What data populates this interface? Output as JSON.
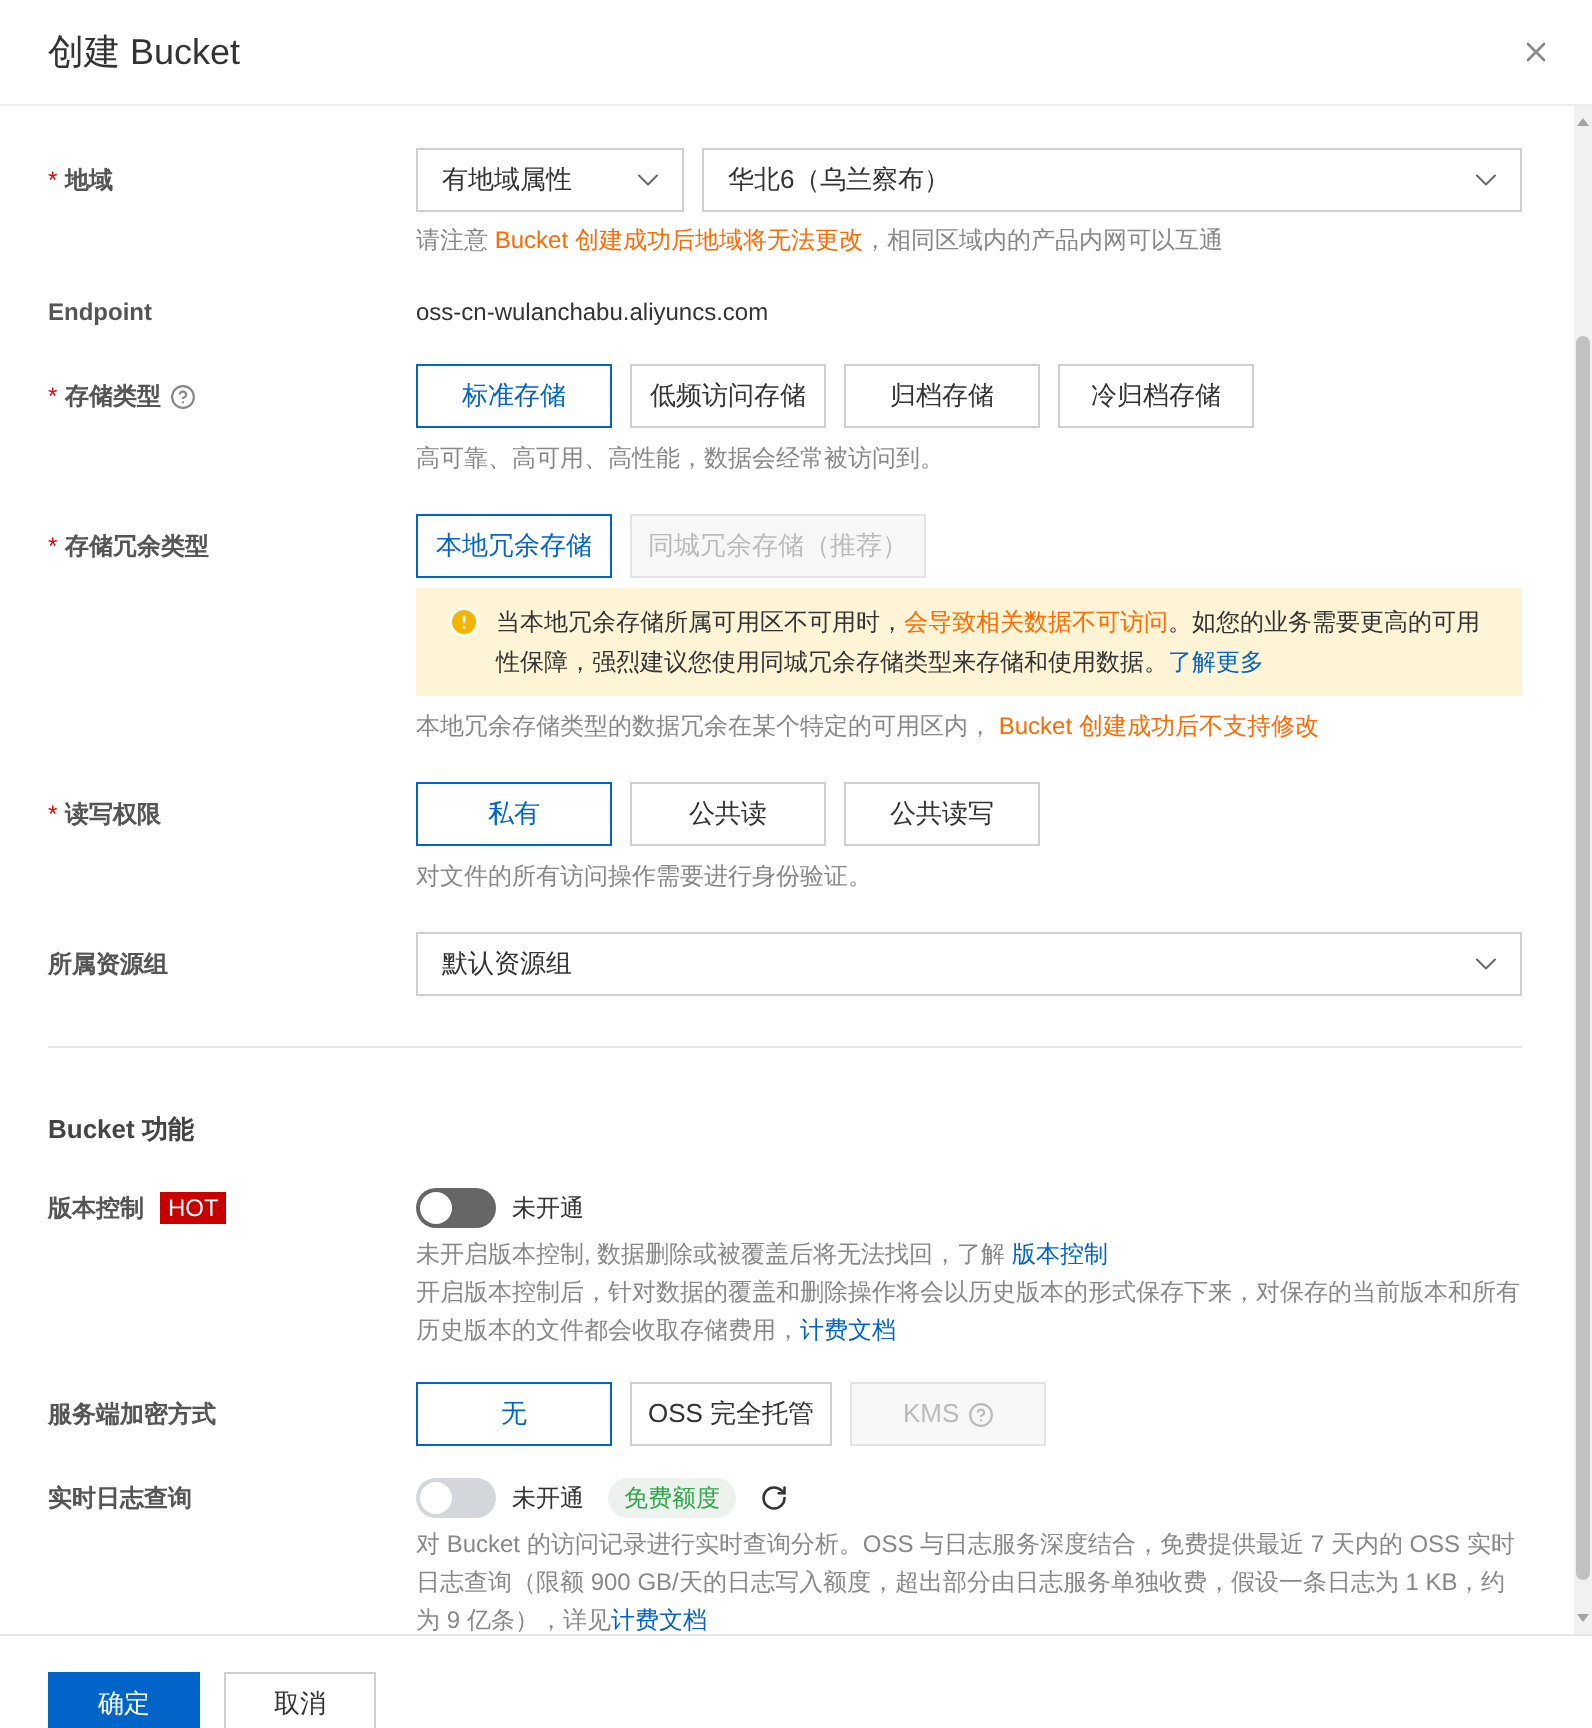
{
  "dialog": {
    "title": "创建 Bucket"
  },
  "basic_rows": [
    {
      "kind": "selects",
      "label": "地域",
      "required_mark": "*",
      "selects": [
        {
          "value": "有地域属性"
        },
        {
          "value": "华北6（乌兰察布）"
        }
      ],
      "notes": [
        [
          {
            "text": "请注意 ",
            "kind": "plain"
          },
          {
            "text": "Bucket 创建成功后地域将无法更改",
            "kind": "warning"
          },
          {
            "text": "，相同区域内的产品内网可以互通",
            "kind": "plain"
          }
        ]
      ]
    },
    {
      "kind": "text",
      "label": "Endpoint",
      "value": "oss-cn-wulanchabu.aliyuncs.com"
    },
    {
      "kind": "options",
      "label": "存储类型",
      "required_mark": "*",
      "help": true,
      "options": [
        {
          "label": "标准存储",
          "selected": true,
          "disabled": false
        },
        {
          "label": "低频访问存储",
          "selected": false,
          "disabled": false
        },
        {
          "label": "归档存储",
          "selected": false,
          "disabled": false
        },
        {
          "label": "冷归档存储",
          "selected": false,
          "disabled": false
        }
      ],
      "notes": [
        [
          {
            "text": "高可靠、高可用、高性能，数据会经常被访问到。",
            "kind": "plain"
          }
        ]
      ]
    },
    {
      "kind": "options",
      "label": "存储冗余类型",
      "required_mark": "*",
      "options": [
        {
          "label": "本地冗余存储",
          "selected": true,
          "disabled": false
        },
        {
          "label": "同城冗余存储（推荐）",
          "selected": false,
          "disabled": true
        }
      ],
      "alert": [
        {
          "text": "当本地冗余存储所属可用区不可用时，",
          "kind": "plain"
        },
        {
          "text": "会导致相关数据不可访问",
          "kind": "warning"
        },
        {
          "text": "。如您的业务需要更高的可用性保障，强烈建议您使用同城冗余存储类型来存储和使用数据。",
          "kind": "plain"
        },
        {
          "text": "了解更多",
          "kind": "link"
        }
      ],
      "notes": [
        [
          {
            "text": "本地冗余存储类型的数据冗余在某个特定的可用区内， ",
            "kind": "plain"
          },
          {
            "text": "Bucket 创建成功后不支持修改",
            "kind": "warning"
          }
        ]
      ]
    },
    {
      "kind": "options",
      "label": "读写权限",
      "required_mark": "*",
      "options": [
        {
          "label": "私有",
          "selected": true,
          "disabled": false
        },
        {
          "label": "公共读",
          "selected": false,
          "disabled": false
        },
        {
          "label": "公共读写",
          "selected": false,
          "disabled": false
        }
      ],
      "notes": [
        [
          {
            "text": "对文件的所有访问操作需要进行身份验证。",
            "kind": "plain"
          }
        ]
      ]
    },
    {
      "kind": "selects",
      "label": "所属资源组",
      "selects": [
        {
          "value": "默认资源组"
        }
      ]
    }
  ],
  "section_title": "Bucket 功能",
  "feature_rows": [
    {
      "kind": "toggle",
      "label": "版本控制",
      "badge": "HOT",
      "toggle": {
        "on": false,
        "disabled": false,
        "status": "未开通"
      },
      "notes": [
        [
          {
            "text": "未开启版本控制, 数据删除或被覆盖后将无法找回，了解 ",
            "kind": "plain"
          },
          {
            "text": "版本控制",
            "kind": "link"
          }
        ],
        [
          {
            "text": "开启版本控制后，针对数据的覆盖和删除操作将会以历史版本的形式保存下来，对保存的当前版本和所有历史版本的文件都会收取存储费用，",
            "kind": "plain"
          },
          {
            "text": "计费文档",
            "kind": "link"
          }
        ]
      ]
    },
    {
      "kind": "options",
      "label": "服务端加密方式",
      "options": [
        {
          "label": "无",
          "selected": true,
          "disabled": false
        },
        {
          "label": "OSS 完全托管",
          "selected": false,
          "disabled": false
        },
        {
          "label": "KMS",
          "selected": false,
          "disabled": true,
          "help": true
        }
      ]
    },
    {
      "kind": "toggle",
      "label": "实时日志查询",
      "toggle": {
        "on": false,
        "disabled": true,
        "status": "未开通"
      },
      "tag": "免费额度",
      "refresh": true,
      "notes": [
        [
          {
            "text": "对 Bucket 的访问记录进行实时查询分析。OSS 与日志服务深度结合，免费提供最近 7 天内的 OSS 实时日志查询（限额 900 GB/天的日志写入额度，超出部分由日志服务单独收费，假设一条日志为 1 KB，约为 9 亿条），详见",
            "kind": "plain"
          },
          {
            "text": "计费文档",
            "kind": "link"
          }
        ]
      ]
    }
  ],
  "footer_buttons": [
    {
      "label": "确定",
      "kind": "primary"
    },
    {
      "label": "取消",
      "kind": "default"
    }
  ]
}
